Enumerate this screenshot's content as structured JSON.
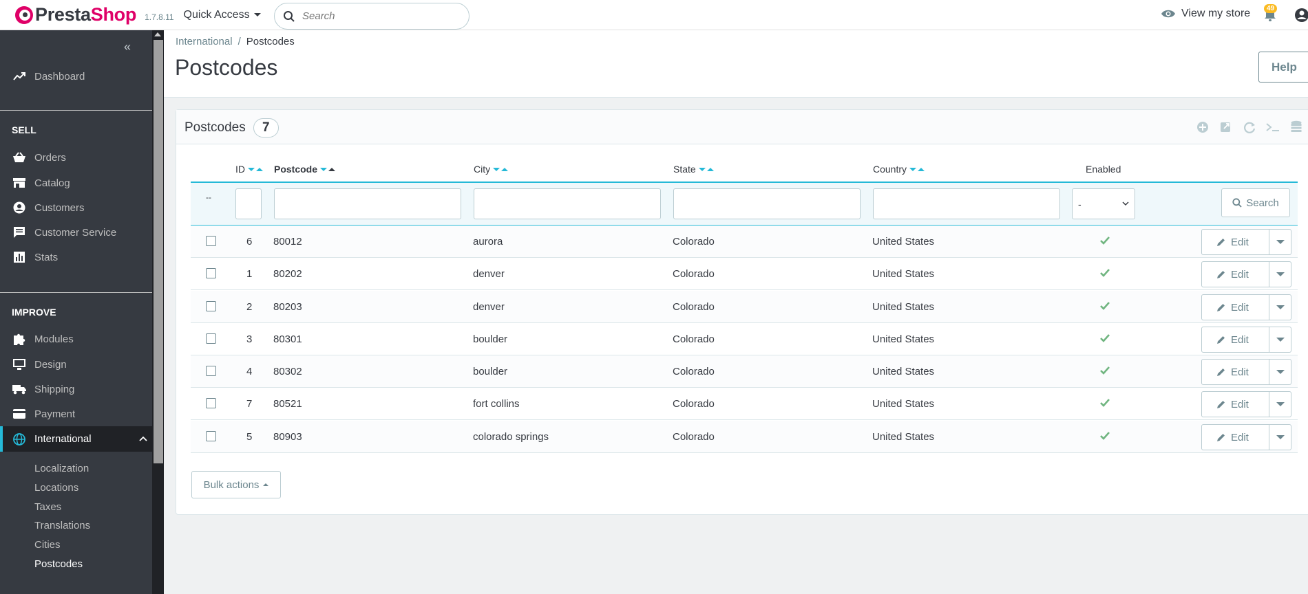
{
  "header": {
    "logo_presta": "Presta",
    "logo_shop": "Shop",
    "version": "1.7.8.11",
    "quick_access": "Quick Access",
    "search_placeholder": "Search",
    "view_store": "View my store",
    "notifications_count": "49"
  },
  "sidebar": {
    "dashboard": "Dashboard",
    "section_sell": "SELL",
    "sell_items": [
      "Orders",
      "Catalog",
      "Customers",
      "Customer Service",
      "Stats"
    ],
    "section_improve": "IMPROVE",
    "improve_items": [
      "Modules",
      "Design",
      "Shipping",
      "Payment"
    ],
    "active_item": "International",
    "sub_items": [
      "Localization",
      "Locations",
      "Taxes",
      "Translations",
      "Cities",
      "Postcodes"
    ]
  },
  "breadcrumb": {
    "parent": "International",
    "separator": "/",
    "current": "Postcodes"
  },
  "page": {
    "title": "Postcodes",
    "help": "Help"
  },
  "panel": {
    "title": "Postcodes",
    "count": "7"
  },
  "table": {
    "columns": {
      "id": "ID",
      "postcode": "Postcode",
      "city": "City",
      "state": "State",
      "country": "Country",
      "enabled": "Enabled"
    },
    "filter": {
      "dash": "--",
      "enabled_selected": "-",
      "search_label": "Search"
    },
    "rows": [
      {
        "id": "6",
        "postcode": "80012",
        "city": "aurora",
        "state": "Colorado",
        "country": "United States"
      },
      {
        "id": "1",
        "postcode": "80202",
        "city": "denver",
        "state": "Colorado",
        "country": "United States"
      },
      {
        "id": "2",
        "postcode": "80203",
        "city": "denver",
        "state": "Colorado",
        "country": "United States"
      },
      {
        "id": "3",
        "postcode": "80301",
        "city": "boulder",
        "state": "Colorado",
        "country": "United States"
      },
      {
        "id": "4",
        "postcode": "80302",
        "city": "boulder",
        "state": "Colorado",
        "country": "United States"
      },
      {
        "id": "7",
        "postcode": "80521",
        "city": "fort collins",
        "state": "Colorado",
        "country": "United States"
      },
      {
        "id": "5",
        "postcode": "80903",
        "city": "colorado springs",
        "state": "Colorado",
        "country": "United States"
      }
    ],
    "edit_label": "Edit",
    "bulk_actions": "Bulk actions"
  },
  "colors": {
    "accent": "#25b9d7",
    "brand": "#df0067",
    "sidebar_bg": "#363a41",
    "enabled_check": "#70b580"
  }
}
